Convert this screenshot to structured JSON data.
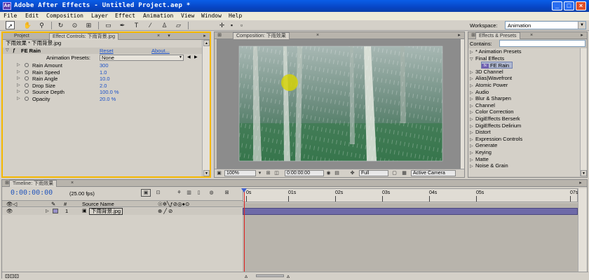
{
  "window": {
    "title": "Adobe After Effects - Untitled Project.aep *",
    "app_icon": "Ae"
  },
  "menu": [
    "File",
    "Edit",
    "Composition",
    "Layer",
    "Effect",
    "Animation",
    "View",
    "Window",
    "Help"
  ],
  "workspace": {
    "label": "Workspace:",
    "value": "Animation"
  },
  "effect_controls": {
    "tab_project": "Project",
    "tab_ec": "Effect Controls: 下雨背景.jpg",
    "layer_path": "下雨效果 * 下雨背景.jpg",
    "effect_name": "FE Rain",
    "reset": "Reset",
    "about": "About...",
    "presets_label": "Animation Presets:",
    "presets_value": "None",
    "params": [
      {
        "name": "Rain Amount",
        "value": "300"
      },
      {
        "name": "Rain Speed",
        "value": "1.0"
      },
      {
        "name": "Rain Angle",
        "value": "10.0"
      },
      {
        "name": "Drop Size",
        "value": "2.0"
      },
      {
        "name": "Source Depth",
        "value": "100.0 %"
      },
      {
        "name": "Opacity",
        "value": "20.0 %"
      }
    ]
  },
  "composition": {
    "tab": "Composition: 下雨效果",
    "zoom": "100%",
    "timecode": "0:00:00:00",
    "resolution": "Full",
    "view": "Active Camera"
  },
  "effects_presets": {
    "tab": "Effects & Presets",
    "contains_label": "Contains:",
    "items": [
      {
        "label": "* Animation Presets",
        "level": 0,
        "open": false
      },
      {
        "label": "Final Effects",
        "level": 0,
        "open": true
      },
      {
        "label": "FE Rain",
        "level": 1,
        "selected": true
      },
      {
        "label": "3D Channel",
        "level": 0
      },
      {
        "label": "Alias|Wavefront",
        "level": 0
      },
      {
        "label": "Atomic Power",
        "level": 0
      },
      {
        "label": "Audio",
        "level": 0
      },
      {
        "label": "Blur & Sharpen",
        "level": 0
      },
      {
        "label": "Channel",
        "level": 0
      },
      {
        "label": "Color Correction",
        "level": 0
      },
      {
        "label": "DigiEffects Berserk",
        "level": 0
      },
      {
        "label": "DigiEffects Delirium",
        "level": 0
      },
      {
        "label": "Distort",
        "level": 0
      },
      {
        "label": "Expression Controls",
        "level": 0
      },
      {
        "label": "Generate",
        "level": 0
      },
      {
        "label": "Keying",
        "level": 0
      },
      {
        "label": "Matte",
        "level": 0
      },
      {
        "label": "Noise & Grain",
        "level": 0
      }
    ]
  },
  "timeline": {
    "tab": "Timeline: 下雨效果",
    "timecode": "0:00:00:00",
    "fps": "(25.00 fps)",
    "col_hash": "#",
    "col_source": "Source Name",
    "layer_num": "1",
    "layer_name": "下雨背景.jpg",
    "ticks": [
      "0s",
      "01s",
      "02s",
      "03s",
      "04s",
      "05s",
      "07s"
    ]
  },
  "colors": {
    "accent_frame": "#f5b800",
    "value_blue": "#1a50c8",
    "layer_bar": "#6e6aa8",
    "cti": "#e02020"
  }
}
